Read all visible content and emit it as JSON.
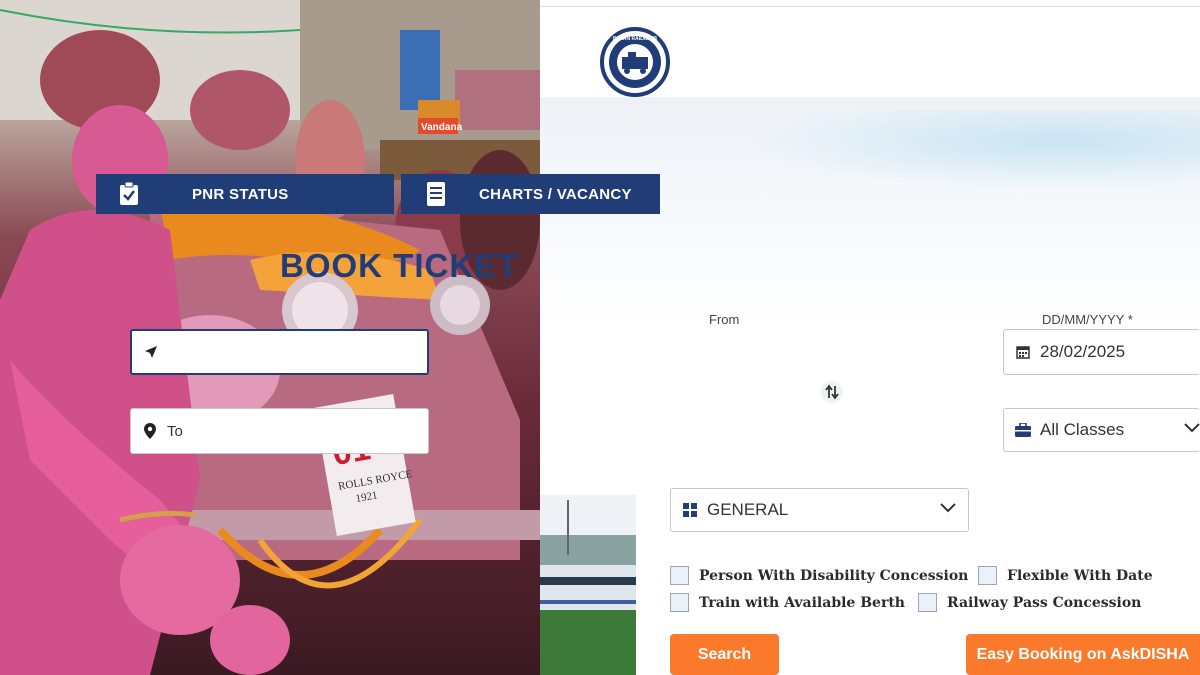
{
  "photo": {
    "plate_number": "01",
    "plate_text": "ROLLS ROYCE",
    "plate_year": "1921",
    "shop_sign": "Vandana"
  },
  "header": {
    "logo_text": "INDIAN RAILWAYS",
    "logo_hindi": "भारतीय रेल"
  },
  "tabs": {
    "pnr_label": "PNR STATUS",
    "charts_label": "CHARTS / VACANCY"
  },
  "form": {
    "title": "BOOK TICKET",
    "from_label": "From",
    "from_value": "",
    "to_placeholder": "To",
    "date_label": "DD/MM/YYYY *",
    "date_value": "28/02/2025",
    "class_value": "All Classes",
    "quota_value": "GENERAL",
    "checkboxes": [
      "Person With Disability Concession",
      "Flexible With Date",
      "Train with Available Berth",
      "Railway Pass Concession"
    ],
    "search_label": "Search",
    "disha_label": "Easy Booking on AskDISHA"
  },
  "colors": {
    "primary": "#213d77",
    "accent": "#fb792b"
  }
}
